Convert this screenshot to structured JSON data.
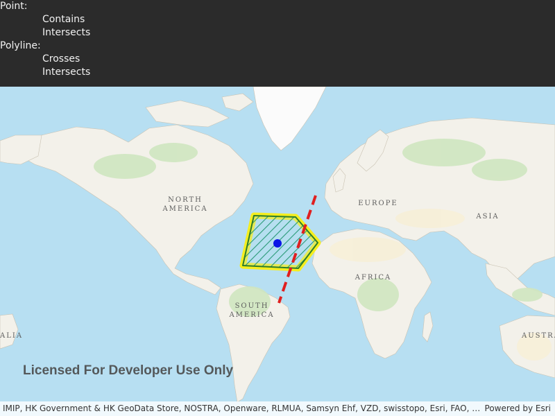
{
  "info_panel": {
    "point_label": "Point:",
    "point_relations": [
      "Contains",
      "Intersects"
    ],
    "polyline_label": "Polyline:",
    "polyline_relations": [
      "Crosses",
      "Intersects"
    ]
  },
  "map": {
    "labels": {
      "north_america": [
        "NORTH",
        "AMERICA"
      ],
      "south_america": [
        "SOUTH",
        "AMERICA"
      ],
      "europe": "EUROPE",
      "asia": "ASIA",
      "africa": "AFRICA",
      "australia_partial": "AUSTRA",
      "left_edge_partial": "ALIA"
    },
    "watermark": "Licensed For Developer Use Only",
    "attribution": "IMIP, HK Government & HK GeoData Store, NOSTRA, Openware, RLMUA, Samsyn Ehf, VZD, swisstopo, Esri, FAO, NOAA, USGS, NR…",
    "powered_by": "Powered by Esri",
    "colors": {
      "ocean": "#b7dff2",
      "land": "#f3f1ea",
      "vegetation": "#cfe6c0",
      "polygon_outline": "#f5ee1f",
      "polygon_hatch": "#2a9a78",
      "point": "#0b16e6",
      "polyline": "#e01f1f"
    }
  }
}
